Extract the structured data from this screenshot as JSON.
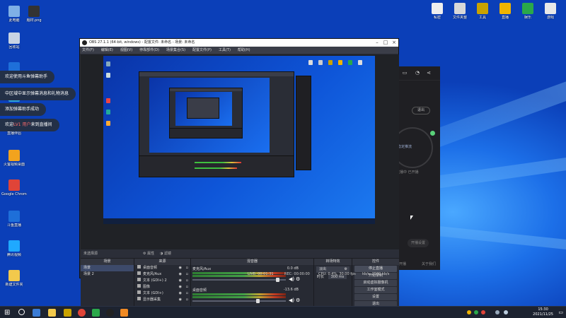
{
  "desktop": {
    "left_icons": [
      {
        "label": "此电脑",
        "color": "#7fb0e6"
      },
      {
        "label": "题材.png",
        "color": "#333"
      },
      {
        "label": "回收站",
        "color": "#c8d4e4"
      },
      {
        "label": "斗鱼直播",
        "color": "#1e6fd9"
      },
      {
        "label": "Microsoft Edge",
        "color": "#2fa6d9"
      },
      {
        "label": "直播伴侣",
        "color": "#6d6d6d"
      },
      {
        "label": "火萤视频桌面",
        "color": "#f2a31e"
      },
      {
        "label": "Google Chrome",
        "color": "#e04438"
      },
      {
        "label": "斗鱼直播",
        "color": "#1e6fd9"
      },
      {
        "label": "腾讯视频",
        "color": "#1fa9ff"
      },
      {
        "label": "新建文件夹",
        "color": "#f2c94c"
      }
    ],
    "top_right_icons": [
      {
        "label": "私密",
        "color": "#eeeeee"
      },
      {
        "label": "文件夹整",
        "color": "#d8d8d8"
      },
      {
        "label": "工具",
        "color": "#c9a200"
      },
      {
        "label": "直播",
        "color": "#f0b400"
      },
      {
        "label": "娱乐",
        "color": "#2aa84a"
      },
      {
        "label": "游戏",
        "color": "#e8e8e8"
      }
    ],
    "toasts": [
      {
        "pre": "欢迎使用斗鱼弹幕助手",
        "hl": "",
        "post": ""
      },
      {
        "pre": "中区域中显示弹幕消息和礼物消息",
        "hl": "",
        "post": ""
      },
      {
        "pre": "添加弹幕助手成功",
        "hl": "",
        "post": ""
      },
      {
        "pre": "欢迎",
        "hl": "LV1 用户",
        "post": "来到直播间"
      }
    ]
  },
  "dark_app": {
    "exit_label": "退出",
    "side_text_1": "稳定推流",
    "side_text_2": "直播中 已开播",
    "pill_label": "开播设置",
    "footer_1": "开播",
    "footer_2": "关于我们"
  },
  "obs": {
    "title": "OBS 27.1.1 (64-bit, windows) - 配置文件: 未命名 - 场景: 未命名",
    "menu": [
      "文件(F)",
      "编辑(E)",
      "视图(V)",
      "停靠部件(D)",
      "场景集合(S)",
      "配置文件(P)",
      "工具(T)",
      "帮助(H)"
    ],
    "scene_bar": {
      "properties": "属性",
      "filters": "滤镜",
      "no_source": "未选择源"
    },
    "docks": {
      "scenes": {
        "header": "场景",
        "items": [
          "场景",
          "场景 2"
        ]
      },
      "sources": {
        "header": "来源",
        "items": [
          "桌面音频",
          "麦克风/Aux",
          "文本 (GDI+) 2",
          "图像",
          "文本 (GDI+)",
          "显示器采集"
        ]
      },
      "mixer": {
        "header": "混音器",
        "channels": [
          {
            "name": "麦克风/Aux",
            "db": "0.0 dB"
          },
          {
            "name": "桌面音频",
            "db": "-13.6 dB"
          }
        ]
      },
      "transitions": {
        "header": "转场特效",
        "type": "淡出",
        "duration_label": "时长",
        "duration": "300 ms"
      },
      "controls": {
        "header": "控件",
        "buttons": [
          "停止直播",
          "开始录制",
          "启动虚拟摄像机",
          "工作室模式",
          "设置",
          "退出"
        ]
      }
    },
    "status": {
      "live": "LIVE: 00:01:31",
      "rec": "REC: 00:00:00",
      "cpu": "CPU: 0.4%, 30.00 fps",
      "kb": "kb/s: 2500 kb/s"
    }
  },
  "taskbar": {
    "time": "15:30",
    "date": "2021/11/25"
  }
}
